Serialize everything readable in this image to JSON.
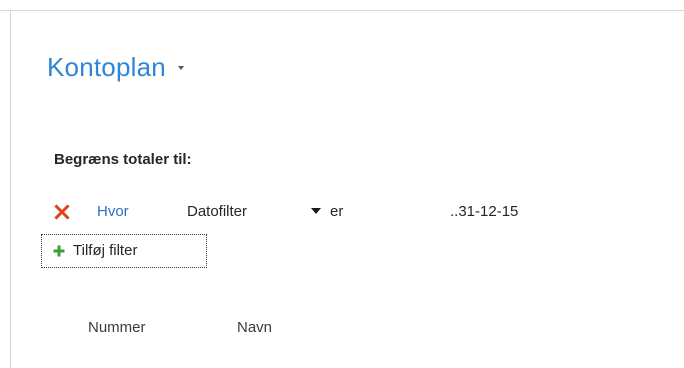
{
  "header": {
    "title": "Kontoplan"
  },
  "filters": {
    "heading": "Begræns totaler til:",
    "row": {
      "where_label": "Hvor",
      "field": "Datofilter",
      "operator": "er",
      "value": "..31-12-15"
    },
    "add_filter_label": "Tilføj filter"
  },
  "table": {
    "columns": [
      "Nummer",
      "Navn"
    ]
  },
  "colors": {
    "title": "#2f86d4",
    "remove_icon": "#e0421b",
    "add_icon": "#3f9c35",
    "link": "#2f6fc7"
  },
  "icons": {
    "remove": "close-x-icon",
    "add": "plus-icon"
  }
}
